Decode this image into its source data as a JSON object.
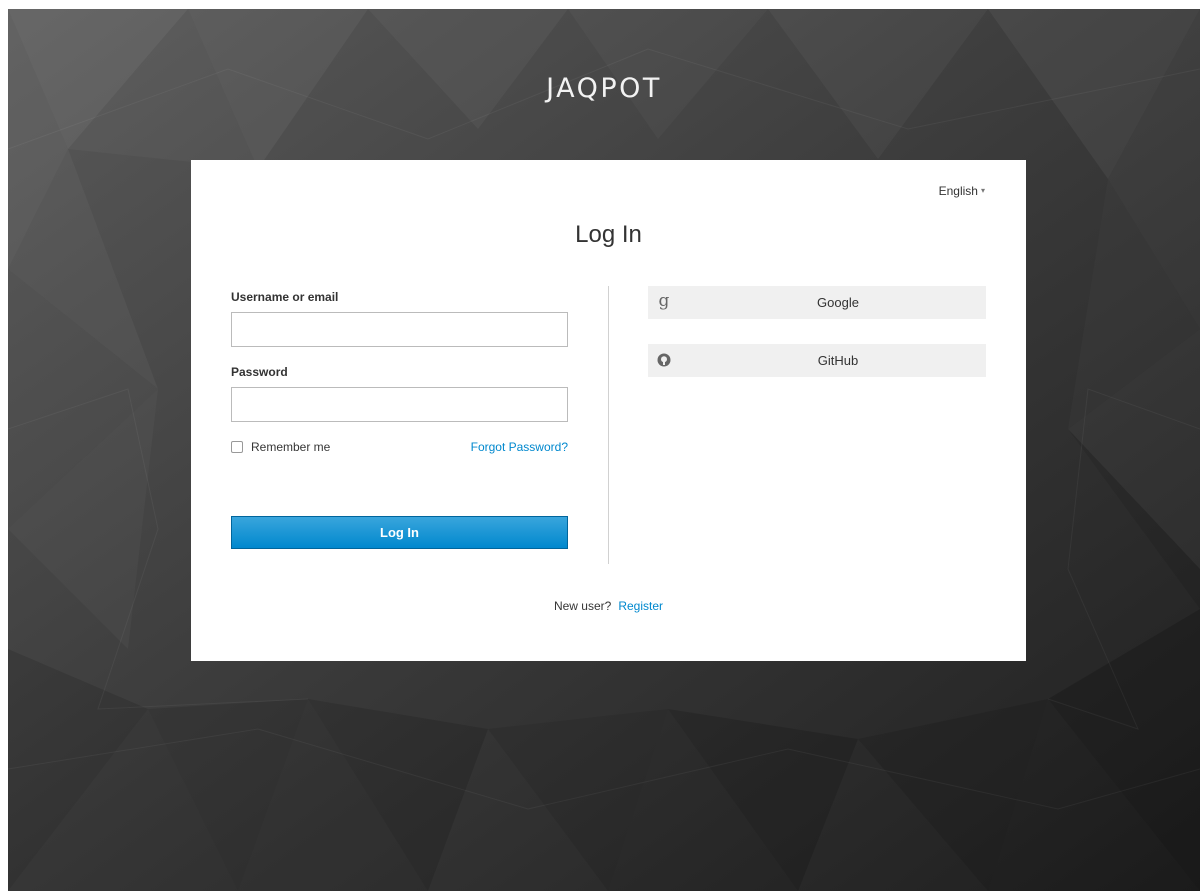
{
  "brand": {
    "title": "JAQPOT"
  },
  "language": {
    "selected": "English",
    "caret": "▾"
  },
  "login": {
    "title": "Log In",
    "username_label": "Username or email",
    "username_value": "",
    "password_label": "Password",
    "password_value": "",
    "remember_label": "Remember me",
    "remember_checked": false,
    "forgot_label": "Forgot Password?",
    "submit_label": "Log In"
  },
  "social": [
    {
      "label": "Google",
      "icon": "google-icon"
    },
    {
      "label": "GitHub",
      "icon": "github-icon"
    }
  ],
  "register": {
    "prompt": "New user?",
    "link": "Register"
  },
  "colors": {
    "accent": "#0088ce",
    "button_top": "#39a5dc",
    "button_bottom": "#0088ce",
    "background_dark": "#2c2c2c",
    "card": "#ffffff",
    "social_bg": "#f0f0f0"
  }
}
